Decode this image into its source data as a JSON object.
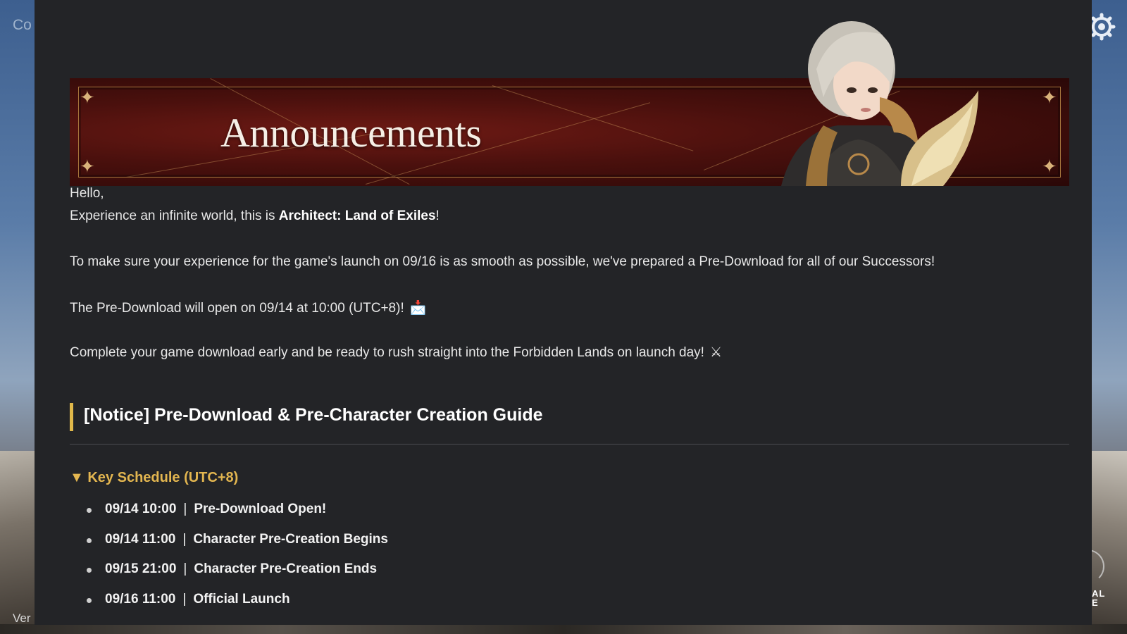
{
  "background": {
    "left_text": "Co",
    "version_text": "Ver",
    "corner_text": "AL",
    "corner_text_2": "E"
  },
  "banner": {
    "title": "Announcements"
  },
  "body": {
    "greeting": "Hello,",
    "intro_prefix": "Experience an infinite world, this is ",
    "intro_game": "Architect: Land of Exiles",
    "intro_suffix": "!",
    "para_predownload_prepared": "To make sure your experience for the game's launch on 09/16 is as smooth as possible, we've prepared a Pre-Download for all of our Successors!",
    "para_predownload_open": "The Pre-Download will open on 09/14 at 10:00 (UTC+8)!",
    "para_predownload_open_emoji": "📩",
    "para_complete": "Complete your game download early and be ready to rush straight into the Forbidden Lands on launch day!",
    "para_complete_emoji": "⚔"
  },
  "notice": {
    "title": "[Notice] Pre-Download & Pre-Character Creation Guide"
  },
  "schedule": {
    "heading": "Key Schedule (UTC+8)",
    "toggle_glyph": "▼",
    "items": [
      {
        "time": "09/14 10:00",
        "event": "Pre-Download Open!"
      },
      {
        "time": "09/14 11:00",
        "event": "Character Pre-Creation Begins"
      },
      {
        "time": "09/15 21:00",
        "event": "Character Pre-Creation Ends"
      },
      {
        "time": "09/16 11:00",
        "event": "Official Launch"
      }
    ]
  },
  "colors": {
    "panel_bg": "#232427",
    "accent_gold": "#e3b650",
    "banner_red": "#4a100d"
  }
}
